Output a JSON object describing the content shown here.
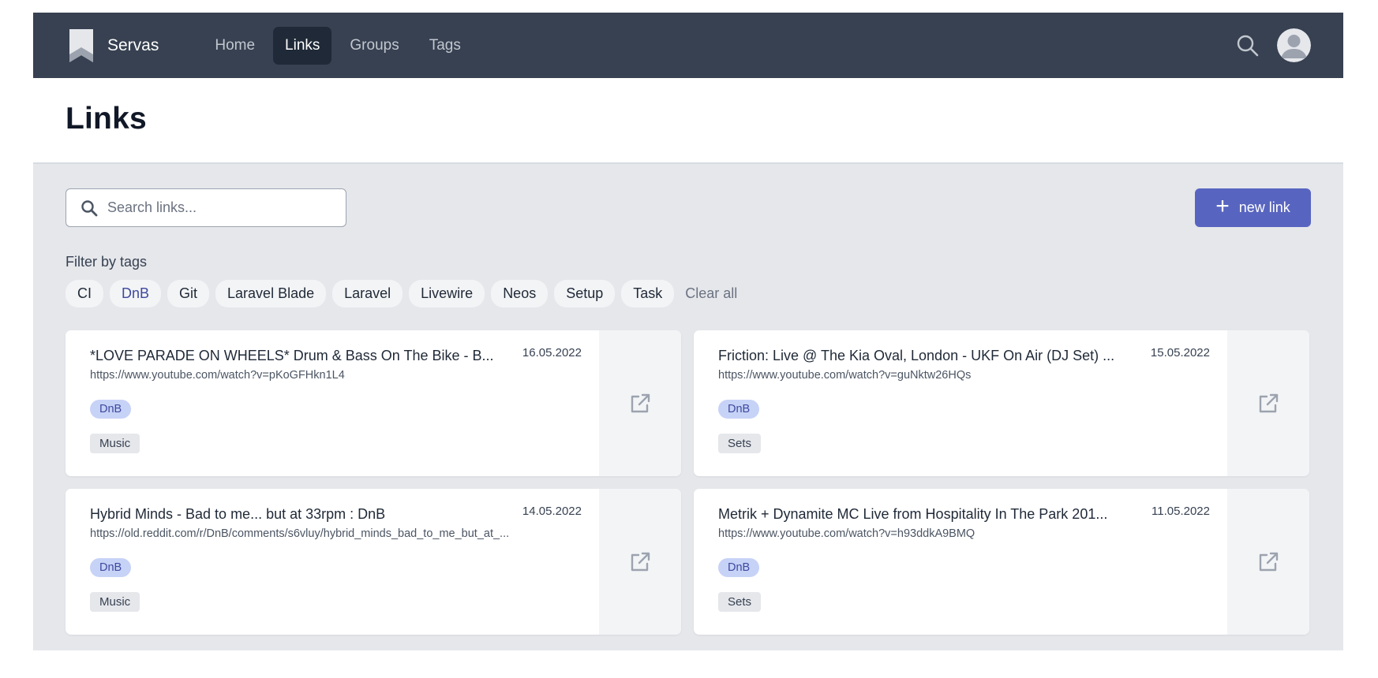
{
  "nav": {
    "brand": "Servas",
    "links": [
      {
        "label": "Home",
        "active": false
      },
      {
        "label": "Links",
        "active": true
      },
      {
        "label": "Groups",
        "active": false
      },
      {
        "label": "Tags",
        "active": false
      }
    ]
  },
  "page": {
    "title": "Links"
  },
  "search": {
    "placeholder": "Search links...",
    "value": ""
  },
  "new_link_button": {
    "label": "new link"
  },
  "filter": {
    "label": "Filter by tags",
    "tags": [
      "CI",
      "DnB",
      "Git",
      "Laravel Blade",
      "Laravel",
      "Livewire",
      "Neos",
      "Setup",
      "Task"
    ],
    "selected": [
      "DnB"
    ],
    "clear_label": "Clear all"
  },
  "links": [
    {
      "title": "*LOVE PARADE ON WHEELS* Drum & Bass On The Bike - B...",
      "date": "16.05.2022",
      "url": "https://www.youtube.com/watch?v=pKoGFHkn1L4",
      "tag": "DnB",
      "group": "Music"
    },
    {
      "title": "Friction: Live @ The Kia Oval, London - UKF On Air (DJ Set) ...",
      "date": "15.05.2022",
      "url": "https://www.youtube.com/watch?v=guNktw26HQs",
      "tag": "DnB",
      "group": "Sets"
    },
    {
      "title": "Hybrid Minds - Bad to me... but at 33rpm : DnB",
      "date": "14.05.2022",
      "url": "https://old.reddit.com/r/DnB/comments/s6vluy/hybrid_minds_bad_to_me_but_at_...",
      "tag": "DnB",
      "group": "Music"
    },
    {
      "title": "Metrik + Dynamite MC Live from Hospitality In The Park 201...",
      "date": "11.05.2022",
      "url": "https://www.youtube.com/watch?v=h93ddkA9BMQ",
      "tag": "DnB",
      "group": "Sets"
    }
  ],
  "colors": {
    "navbar": "#374151",
    "primary": "#5865c0",
    "content_bg": "#e5e7eb",
    "badge_bg": "#c7d2f7",
    "badge_text": "#3e4a9e"
  },
  "icons": {
    "brand": "bookmark-icon",
    "nav_search": "search-icon",
    "avatar": "user-avatar-icon",
    "search_field": "search-icon",
    "new_link": "plus-icon",
    "open_link": "external-link-icon"
  }
}
